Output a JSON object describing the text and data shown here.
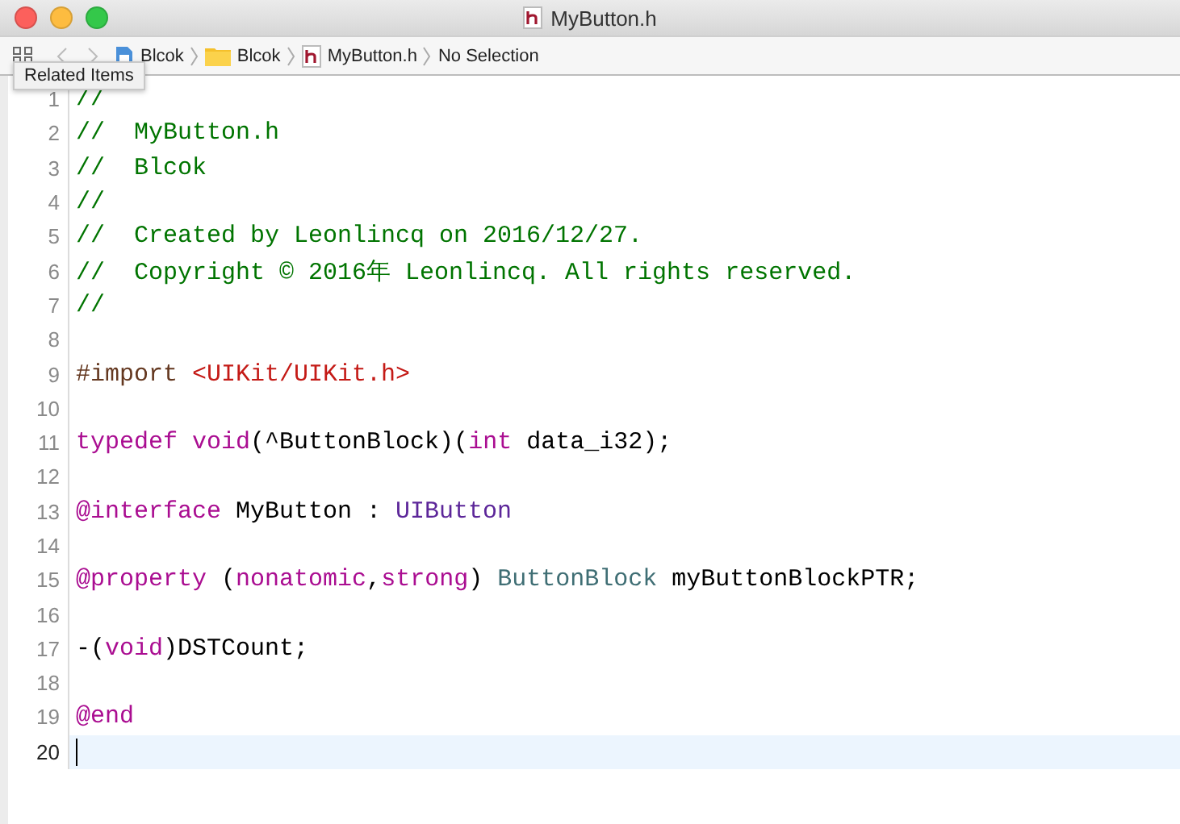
{
  "window": {
    "title": "MyButton.h"
  },
  "jump_bar": {
    "items": [
      {
        "label": "Blcok",
        "kind": "project"
      },
      {
        "label": "Blcok",
        "kind": "folder"
      },
      {
        "label": "MyButton.h",
        "kind": "header"
      },
      {
        "label": "No Selection",
        "kind": "plain"
      }
    ]
  },
  "tooltip": "Related Items",
  "editor": {
    "lines": [
      {
        "number": "1",
        "current": false,
        "tokens": [
          {
            "text": "//",
            "kind": "comment"
          }
        ]
      },
      {
        "number": "2",
        "current": false,
        "tokens": [
          {
            "text": "//  MyButton.h",
            "kind": "comment"
          }
        ]
      },
      {
        "number": "3",
        "current": false,
        "tokens": [
          {
            "text": "//  Blcok",
            "kind": "comment"
          }
        ]
      },
      {
        "number": "4",
        "current": false,
        "tokens": [
          {
            "text": "//",
            "kind": "comment"
          }
        ]
      },
      {
        "number": "5",
        "current": false,
        "tokens": [
          {
            "text": "//  Created by Leonlincq on 2016/12/27.",
            "kind": "comment"
          }
        ]
      },
      {
        "number": "6",
        "current": false,
        "tokens": [
          {
            "text": "//  Copyright © 2016年 Leonlincq. All rights reserved.",
            "kind": "comment"
          }
        ]
      },
      {
        "number": "7",
        "current": false,
        "tokens": [
          {
            "text": "//",
            "kind": "comment"
          }
        ]
      },
      {
        "number": "8",
        "current": false
      },
      {
        "number": "9",
        "current": false,
        "tokens": [
          {
            "text": "#import ",
            "kind": "preproc"
          },
          {
            "text": "<UIKit/UIKit.h>",
            "kind": "string"
          }
        ]
      },
      {
        "number": "10",
        "current": false
      },
      {
        "number": "11",
        "current": false,
        "tokens": [
          {
            "text": "typedef void",
            "kind": "keyword"
          },
          {
            "text": "(^ButtonBlock)(",
            "kind": "plain"
          },
          {
            "text": "int",
            "kind": "keyword"
          },
          {
            "text": " data_i32);",
            "kind": "plain"
          }
        ]
      },
      {
        "number": "12",
        "current": false
      },
      {
        "number": "13",
        "current": false,
        "tokens": [
          {
            "text": "@interface",
            "kind": "keyword"
          },
          {
            "text": " MyButton : ",
            "kind": "plain"
          },
          {
            "text": "UIButton",
            "kind": "type"
          }
        ]
      },
      {
        "number": "14",
        "current": false
      },
      {
        "number": "15",
        "current": false,
        "tokens": [
          {
            "text": "@property",
            "kind": "keyword"
          },
          {
            "text": " (",
            "kind": "plain"
          },
          {
            "text": "nonatomic",
            "kind": "keyword"
          },
          {
            "text": ",",
            "kind": "plain"
          },
          {
            "text": "strong",
            "kind": "keyword"
          },
          {
            "text": ") ",
            "kind": "plain"
          },
          {
            "text": "ButtonBlock",
            "kind": "usertype"
          },
          {
            "text": " myButtonBlockPTR;",
            "kind": "plain"
          }
        ]
      },
      {
        "number": "16",
        "current": false
      },
      {
        "number": "17",
        "current": false,
        "tokens": [
          {
            "text": "-(",
            "kind": "plain"
          },
          {
            "text": "void",
            "kind": "keyword"
          },
          {
            "text": ")DSTCount;",
            "kind": "plain"
          }
        ]
      },
      {
        "number": "18",
        "current": false
      },
      {
        "number": "19",
        "current": false,
        "tokens": [
          {
            "text": "@end",
            "kind": "keyword"
          }
        ]
      },
      {
        "number": "20",
        "current": true
      }
    ]
  }
}
